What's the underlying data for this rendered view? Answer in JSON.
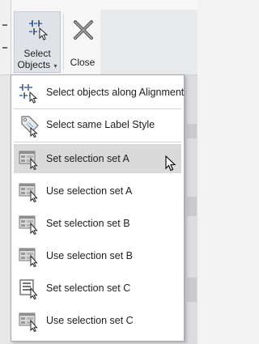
{
  "ribbon": {
    "select_objects": {
      "line1": "Select",
      "line2": "Objects",
      "caret": "▾",
      "icon": "select-along-alignment-icon"
    },
    "close": {
      "label": "Close",
      "icon": "close-x-icon"
    }
  },
  "menu": {
    "items": [
      {
        "label": "Select objects along Alignment",
        "icon": "select-along-alignment-icon"
      },
      {
        "label": "Select same Label Style",
        "icon": "label-tag-icon"
      },
      {
        "label": "Set selection set A",
        "icon": "selection-set-icon",
        "state": "hover"
      },
      {
        "label": "Use selection set A",
        "icon": "selection-set-icon"
      },
      {
        "label": "Set selection set B",
        "icon": "selection-set-icon"
      },
      {
        "label": "Use selection set B",
        "icon": "selection-set-icon"
      },
      {
        "label": "Set selection set C",
        "icon": "selection-list-icon"
      },
      {
        "label": "Use selection set C",
        "icon": "selection-set-icon"
      }
    ]
  },
  "colors": {
    "accent": "#1f6fd1",
    "hover": "#dadada",
    "menu_border": "#a9a9a9"
  }
}
